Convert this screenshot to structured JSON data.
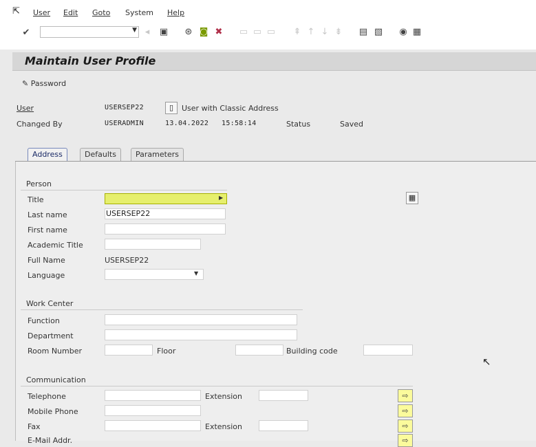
{
  "menu": {
    "items": [
      "User",
      "Edit",
      "Goto",
      "System",
      "Help"
    ]
  },
  "toolbar": {
    "icons": [
      "enter-icon",
      "save-icon",
      "back-icon",
      "exit-icon",
      "cancel-icon",
      "print-icon",
      "find-icon",
      "find-next-icon",
      "first-page-icon",
      "previous-page-icon",
      "next-page-icon",
      "last-page-icon",
      "new-session-icon",
      "shortcut-icon",
      "help-icon",
      "layout-icon"
    ]
  },
  "header": {
    "title": "Maintain User Profile"
  },
  "app_toolbar": {
    "password_label": "Password"
  },
  "info": {
    "user_label": "User",
    "user_value": "USERSEP22",
    "user_type": "User with Classic Address",
    "changed_by_label": "Changed By",
    "changed_by_value": "USERADMIN",
    "changed_date": "13.04.2022",
    "changed_time": "15:58:14",
    "status_label": "Status",
    "status_value": "Saved"
  },
  "tabs": [
    "Address",
    "Defaults",
    "Parameters"
  ],
  "person": {
    "group_title": "Person",
    "title_label": "Title",
    "title_value": "",
    "last_name_label": "Last name",
    "last_name_value": "USERSEP22",
    "first_name_label": "First name",
    "first_name_value": "",
    "academic_title_label": "Academic Title",
    "academic_title_value": "",
    "full_name_label": "Full Name",
    "full_name_value": "USERSEP22",
    "language_label": "Language",
    "language_value": ""
  },
  "work_center": {
    "group_title": "Work Center",
    "function_label": "Function",
    "department_label": "Department",
    "room_label": "Room Number",
    "floor_label": "Floor",
    "building_label": "Building code"
  },
  "communication": {
    "group_title": "Communication",
    "telephone_label": "Telephone",
    "extension_label": "Extension",
    "mobile_label": "Mobile Phone",
    "fax_label": "Fax",
    "fax_extension_label": "Extension",
    "email_label": "E-Mail Addr."
  }
}
